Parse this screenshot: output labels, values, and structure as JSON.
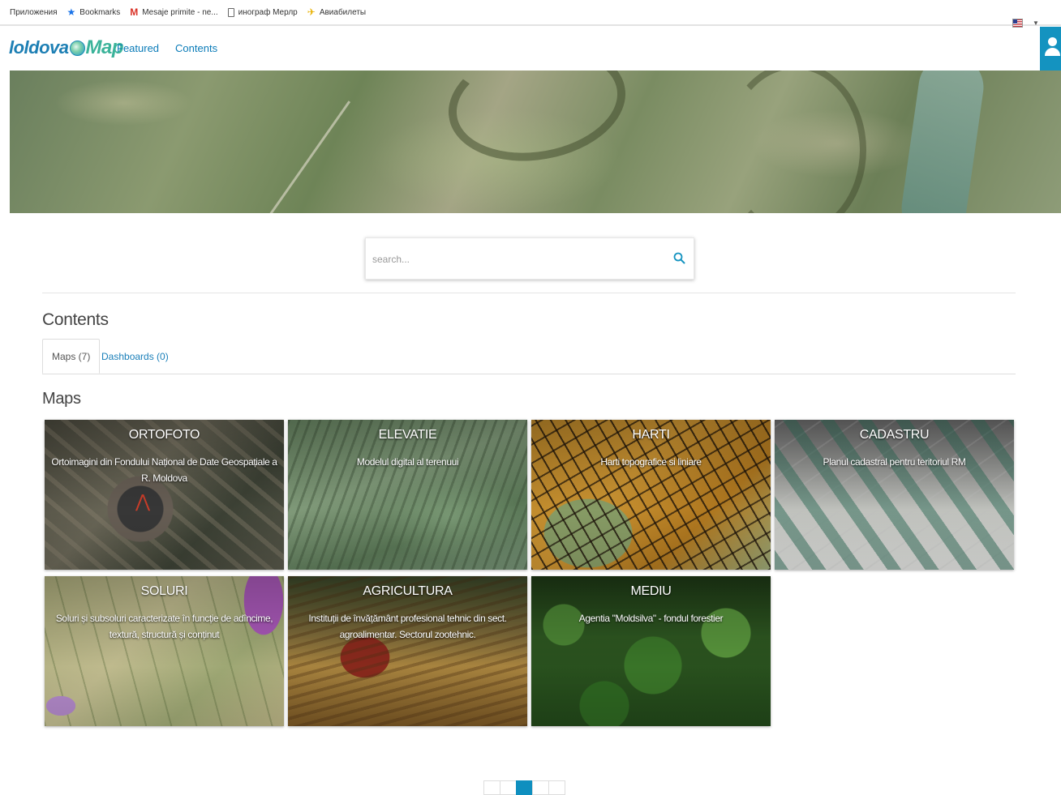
{
  "bookmarks": {
    "items": [
      {
        "label": "Приложения",
        "icon": "apps-icon"
      },
      {
        "label": "Bookmarks",
        "icon": "star-icon"
      },
      {
        "label": "Mesaje primite - ne...",
        "icon": "gmail-icon"
      },
      {
        "label": "инограф Мерлр",
        "icon": "document-icon"
      },
      {
        "label": "Авиабилеты",
        "icon": "plane-icon"
      }
    ]
  },
  "nav": {
    "logo_prefix": "loldova",
    "logo_suffix": "Map",
    "links": [
      "Featured",
      "Contents"
    ],
    "language_icon": "us-flag-icon",
    "user_icon": "user-icon",
    "accent_color": "#1493c0"
  },
  "search": {
    "placeholder": "search...",
    "value": "",
    "icon": "search-icon"
  },
  "contents": {
    "title": "Contents",
    "tabs": [
      {
        "label": "Maps (7)",
        "active": true
      },
      {
        "label": "Dashboards (0)",
        "active": false
      }
    ]
  },
  "maps": {
    "title": "Maps",
    "cards": [
      {
        "title": "ORTOFOTO",
        "description": "Ortoimagini din Fondului Național de Date Geospațiale a R. Moldova"
      },
      {
        "title": "ELEVATIE",
        "description": "Modelul digital al terenuui"
      },
      {
        "title": "HARTI",
        "description": "Harti topografice si liniare"
      },
      {
        "title": "CADASTRU",
        "description": "Planul cadastral pentru teritoriul RM"
      },
      {
        "title": "SOLURI",
        "description": "Soluri și subsoluri caracterizate în funcție de adîncime, textură, structură și conținut"
      },
      {
        "title": "AGRICULTURA",
        "description": "Instituții de învățământ profesional tehnic din sect. agroalimentar. Sectorul zootehnic."
      },
      {
        "title": "MEDIU",
        "description": "Agentia \"Moldsilva\" - fondul forestier"
      }
    ]
  },
  "pagination": {
    "pages": 5,
    "active_index": 2,
    "active_color": "#0f8fbf"
  }
}
